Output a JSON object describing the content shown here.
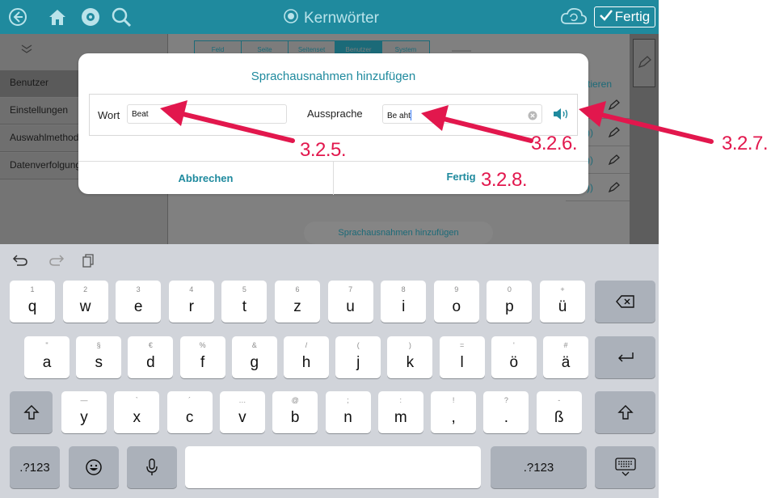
{
  "topbar": {
    "title": "Kernwörter",
    "back_icon": "back-circle-icon",
    "home_icon": "home-icon",
    "dashboard_icon": "dashboard-icon",
    "search_icon": "search-icon",
    "target_icon": "target-icon",
    "sync_icon": "cloud-sync-icon",
    "done_label": "Fertig"
  },
  "background": {
    "tabs": [
      "Feld",
      "Seite",
      "Seitenset",
      "Benutzer",
      "System"
    ],
    "active_tab_index": 3,
    "sidebar_items": [
      "Benutzer",
      "Einstellungen",
      "Auswahlmethode",
      "Datenverfolgung"
    ],
    "column_header": "tieren",
    "add_button": "Sprachausnahmen hinzufügen"
  },
  "dialog": {
    "title": "Sprachausnahmen hinzufügen",
    "word_label": "Wort",
    "word_value": "Beat",
    "pron_label": "Aussprache",
    "pron_value": "Be aht",
    "cancel_label": "Abbrechen",
    "done_label": "Fertig"
  },
  "annotations": [
    "3.2.5.",
    "3.2.6.",
    "3.2.7.",
    "3.2.8."
  ],
  "keyboard": {
    "row1": [
      {
        "p": "q",
        "s": "1"
      },
      {
        "p": "w",
        "s": "2"
      },
      {
        "p": "e",
        "s": "3"
      },
      {
        "p": "r",
        "s": "4"
      },
      {
        "p": "t",
        "s": "5"
      },
      {
        "p": "z",
        "s": "6"
      },
      {
        "p": "u",
        "s": "7"
      },
      {
        "p": "i",
        "s": "8"
      },
      {
        "p": "o",
        "s": "9"
      },
      {
        "p": "p",
        "s": "0"
      },
      {
        "p": "ü",
        "s": "+"
      }
    ],
    "row2": [
      {
        "p": "a",
        "s": "\""
      },
      {
        "p": "s",
        "s": "§"
      },
      {
        "p": "d",
        "s": "€"
      },
      {
        "p": "f",
        "s": "%"
      },
      {
        "p": "g",
        "s": "&"
      },
      {
        "p": "h",
        "s": "/"
      },
      {
        "p": "j",
        "s": "("
      },
      {
        "p": "k",
        "s": ")"
      },
      {
        "p": "l",
        "s": "="
      },
      {
        "p": "ö",
        "s": "'"
      },
      {
        "p": "ä",
        "s": "#"
      }
    ],
    "row3": [
      {
        "p": "y",
        "s": "—"
      },
      {
        "p": "x",
        "s": "`"
      },
      {
        "p": "c",
        "s": "´"
      },
      {
        "p": "v",
        "s": "…"
      },
      {
        "p": "b",
        "s": "@"
      },
      {
        "p": "n",
        "s": ";"
      },
      {
        "p": "m",
        "s": ":"
      },
      {
        "p": ",",
        "s": "!"
      },
      {
        "p": ".",
        "s": "?"
      },
      {
        "p": "ß",
        "s": "-"
      }
    ],
    "numbers_label": ".?123"
  },
  "colors": {
    "accent": "#1f8a9e",
    "annotation": "#e2174d"
  }
}
